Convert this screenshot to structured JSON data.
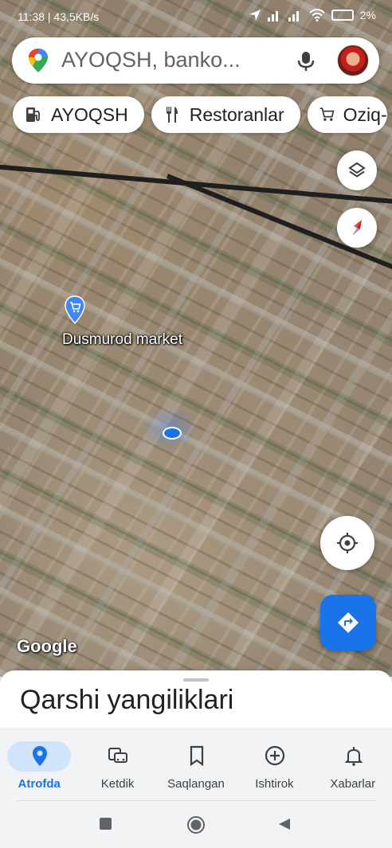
{
  "status_bar": {
    "time": "11:38",
    "speed": "43,5KB/s",
    "battery": "2%"
  },
  "search": {
    "text": "AYOQSH, banko..."
  },
  "chips": [
    {
      "label": "AYOQSH",
      "icon": "gas-station-icon"
    },
    {
      "label": "Restoranlar",
      "icon": "restaurant-icon"
    },
    {
      "label": "Oziq-",
      "icon": "cart-icon"
    }
  ],
  "map": {
    "place_name": "Dusmurod market",
    "attribution": "Google"
  },
  "sheet": {
    "title": "Qarshi yangiliklari"
  },
  "nav": {
    "items": [
      {
        "label": "Atrofda",
        "icon": "location-pin-icon",
        "active": true
      },
      {
        "label": "Ketdik",
        "icon": "commute-icon",
        "active": false
      },
      {
        "label": "Saqlangan",
        "icon": "bookmark-icon",
        "active": false
      },
      {
        "label": "Ishtirok",
        "icon": "add-circle-icon",
        "active": false
      },
      {
        "label": "Xabarlar",
        "icon": "bell-icon",
        "active": false
      }
    ]
  },
  "colors": {
    "accent": "#1a73e8",
    "active_pill": "#d2e3fc"
  }
}
